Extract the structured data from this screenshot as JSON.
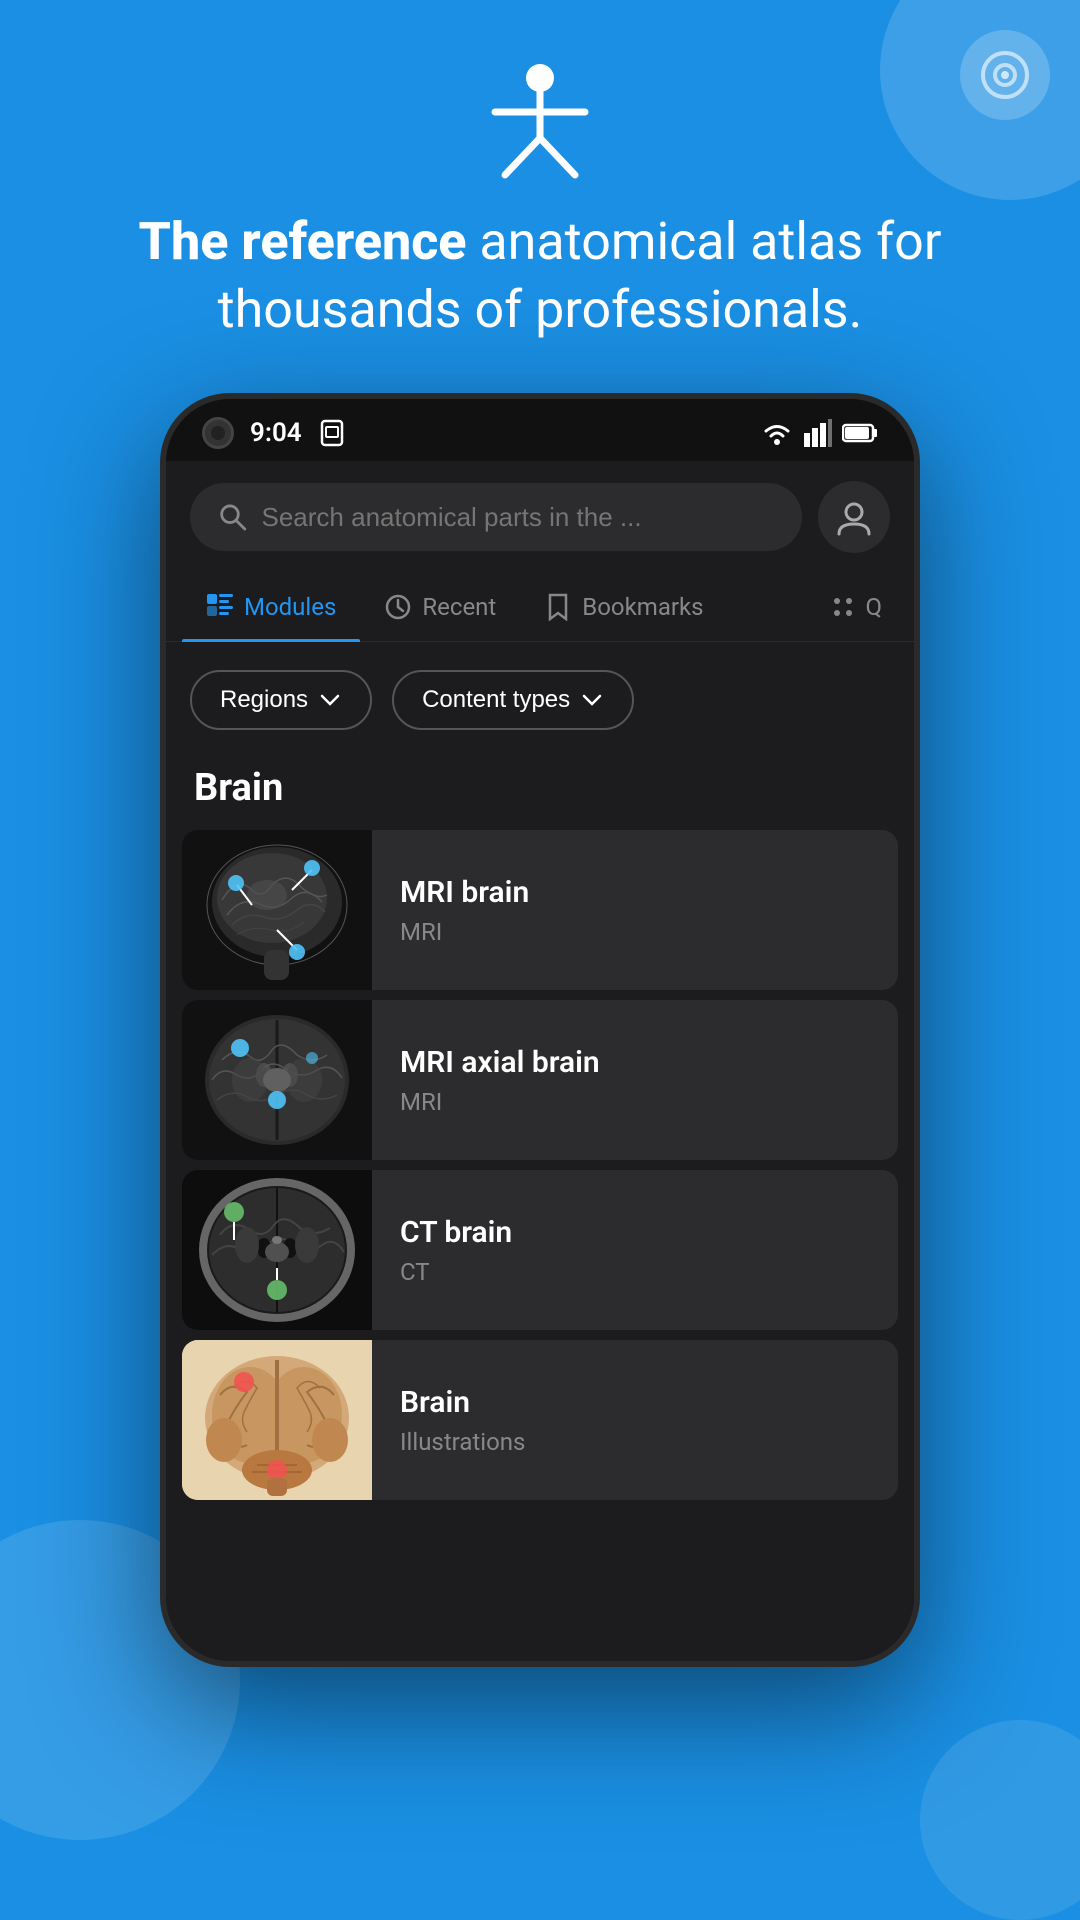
{
  "background_color": "#1a8fe3",
  "hero": {
    "title_bold": "The reference",
    "title_rest": " anatomical atlas for thousands of professionals.",
    "icon_label": "person-icon"
  },
  "status_bar": {
    "time": "9:04",
    "camera_icon": "camera-icon"
  },
  "search": {
    "placeholder": "Search anatomical parts in the ...",
    "profile_icon": "profile-icon"
  },
  "nav_tabs": [
    {
      "id": "modules",
      "label": "Modules",
      "icon": "modules-icon",
      "active": true
    },
    {
      "id": "recent",
      "label": "Recent",
      "icon": "recent-icon",
      "active": false
    },
    {
      "id": "bookmarks",
      "label": "Bookmarks",
      "icon": "bookmarks-icon",
      "active": false
    }
  ],
  "filters": [
    {
      "id": "regions",
      "label": "Regions",
      "icon": "chevron-down-icon"
    },
    {
      "id": "content-types",
      "label": "Content types",
      "icon": "chevron-down-icon"
    }
  ],
  "section": {
    "title": "Brain"
  },
  "modules": [
    {
      "id": "mri-brain",
      "name": "MRI brain",
      "type": "MRI",
      "thumb_type": "mri_sagittal"
    },
    {
      "id": "mri-axial-brain",
      "name": "MRI axial brain",
      "type": "MRI",
      "thumb_type": "mri_axial"
    },
    {
      "id": "ct-brain",
      "name": "CT brain",
      "type": "CT",
      "thumb_type": "ct"
    },
    {
      "id": "brain",
      "name": "Brain",
      "type": "Illustrations",
      "thumb_type": "illustration"
    }
  ],
  "accent_color": "#2196f3",
  "colors": {
    "pin_blue": "#4fc3f7",
    "pin_green": "#66bb6a",
    "pin_red": "#ef5350"
  }
}
